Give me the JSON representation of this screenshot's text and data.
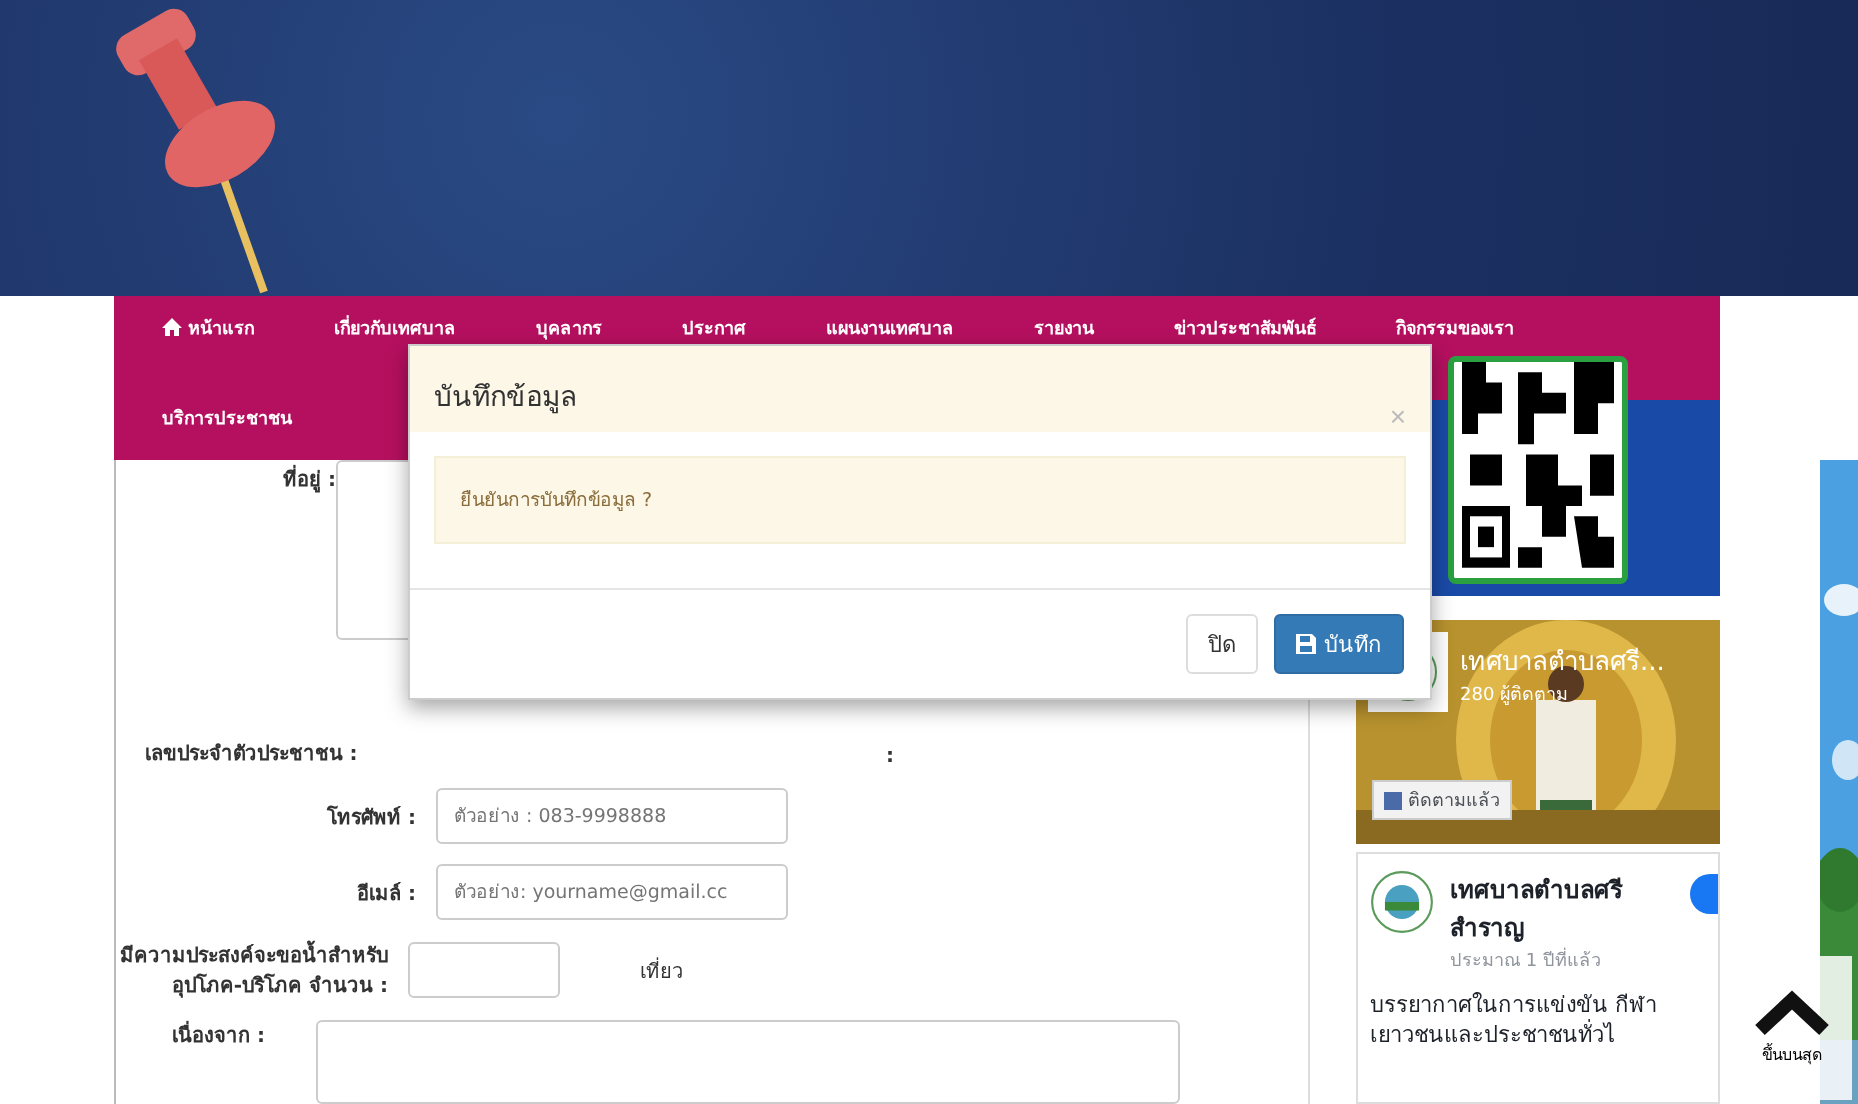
{
  "nav": {
    "items": [
      {
        "label": "หน้าแรก",
        "icon": true
      },
      {
        "label": "เกี่ยวกับเทศบาล"
      },
      {
        "label": "บุคลากร"
      },
      {
        "label": "ประกาศ"
      },
      {
        "label": "แผนงานเทศบาล"
      },
      {
        "label": "รายงาน"
      },
      {
        "label": "ข่าวประชาสัมพันธ์"
      },
      {
        "label": "กิจกรรมของเรา"
      },
      {
        "label": "บริการประชาชน"
      }
    ]
  },
  "form": {
    "fields": [
      {
        "label": "ที่อยู่ :",
        "kind": "textarea"
      },
      {
        "label": "เลขประจำตัวประชาชน :",
        "kind": "hidden",
        "extra": ":"
      },
      {
        "label": "โทรศัพท์ :",
        "kind": "input",
        "placeholder": "ตัวอย่าง : 083-9998888"
      },
      {
        "label": "อีเมล์ :",
        "kind": "input",
        "placeholder": "ตัวอย่าง: yourname@gmail.cc"
      },
      {
        "label": "มีความประสงค์จะขอน้ำสำหรับอุปโภค-บริโภค จำนวน :",
        "kind": "small",
        "suffix": "เที่ยว"
      },
      {
        "label": "เนื่องจาก :",
        "kind": "textarea-bottom"
      }
    ]
  },
  "sidebar": {
    "page": {
      "name": "เทศบาลตำบลศรี...",
      "followers": "280 ผู้ติดตาม",
      "follow": "ติดตามแล้ว"
    },
    "post": {
      "author": "เทศบาลตำบลศรีสำราญ",
      "time": "ประมาณ 1 ปีที่แล้ว",
      "text": "บรรยากาศในการแข่งขัน กีฬาเยาวชนและประชาชนทั่วไ"
    }
  },
  "back_to_top": {
    "label": "ขึ้นบนสุด"
  },
  "modal": {
    "title": "บันทึกข้อมูล",
    "close": "×",
    "message": "ยืนยันการบันทึกข้อมูล ?",
    "buttons": [
      {
        "label": "ปิด",
        "kind": "default"
      },
      {
        "label": "บันทึก",
        "kind": "primary"
      }
    ]
  }
}
